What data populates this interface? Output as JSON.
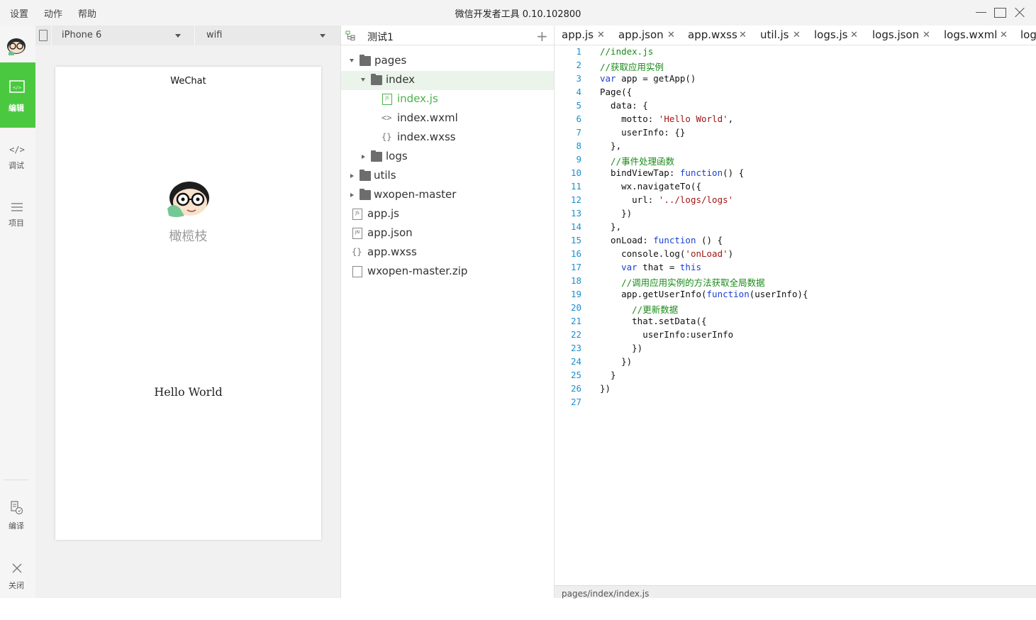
{
  "menu": [
    "设置",
    "动作",
    "帮助"
  ],
  "app_title": "微信开发者工具 0.10.102800",
  "sidebar": {
    "items": [
      {
        "label": "编辑",
        "icon": "code-box-icon",
        "active": true
      },
      {
        "label": "调试",
        "icon": "code-brackets-icon",
        "active": false
      },
      {
        "label": "项目",
        "icon": "list-icon",
        "active": false
      },
      {
        "label": "编译",
        "icon": "compile-icon",
        "active": false
      },
      {
        "label": "关闭",
        "icon": "close-icon",
        "active": false
      }
    ]
  },
  "simulator": {
    "device": "iPhone 6",
    "network": "wifi",
    "nav_title": "WeChat",
    "nickname": "橄榄枝",
    "motto": "Hello World"
  },
  "file_tree": {
    "project": "测试1",
    "rows": [
      {
        "name": "pages",
        "type": "folder",
        "expanded": true
      },
      {
        "name": "index",
        "type": "folder",
        "expanded": true
      },
      {
        "name": "index.js",
        "type": "js",
        "tag": "JS"
      },
      {
        "name": "index.wxml",
        "type": "wxml",
        "tag": "<>"
      },
      {
        "name": "index.wxss",
        "type": "wxss",
        "tag": "{}"
      },
      {
        "name": "logs",
        "type": "folder",
        "expanded": false
      },
      {
        "name": "utils",
        "type": "folder",
        "expanded": false
      },
      {
        "name": "wxopen-master",
        "type": "folder",
        "expanded": false
      },
      {
        "name": "app.js",
        "type": "js",
        "tag": "JS"
      },
      {
        "name": "app.json",
        "type": "json",
        "tag": "JN"
      },
      {
        "name": "app.wxss",
        "type": "wxss",
        "tag": "{}"
      },
      {
        "name": "wxopen-master.zip",
        "type": "file",
        "tag": ""
      }
    ]
  },
  "editor": {
    "tabs": [
      "app.js",
      "app.json",
      "app.wxss",
      "util.js",
      "logs.js",
      "logs.json",
      "logs.wxml",
      "log"
    ],
    "code": [
      [
        [
          "c",
          "//index.js"
        ]
      ],
      [
        [
          "c",
          "//获取应用实例"
        ]
      ],
      [
        [
          "k",
          "var"
        ],
        [
          "t",
          " app = getApp()"
        ]
      ],
      [
        [
          "t",
          "Page({"
        ]
      ],
      [
        [
          "t",
          "  data: {"
        ]
      ],
      [
        [
          "t",
          "    motto: "
        ],
        [
          "s",
          "'Hello World'"
        ],
        [
          "t",
          ","
        ]
      ],
      [
        [
          "t",
          "    userInfo: {}"
        ]
      ],
      [
        [
          "t",
          "  },"
        ]
      ],
      [
        [
          "c",
          "  //事件处理函数"
        ]
      ],
      [
        [
          "t",
          "  bindViewTap: "
        ],
        [
          "k",
          "function"
        ],
        [
          "t",
          "() {"
        ]
      ],
      [
        [
          "t",
          "    wx.navigateTo({"
        ]
      ],
      [
        [
          "t",
          "      url: "
        ],
        [
          "s",
          "'../logs/logs'"
        ]
      ],
      [
        [
          "t",
          "    })"
        ]
      ],
      [
        [
          "t",
          "  },"
        ]
      ],
      [
        [
          "t",
          "  onLoad: "
        ],
        [
          "k",
          "function"
        ],
        [
          "t",
          " () {"
        ]
      ],
      [
        [
          "t",
          "    console.log("
        ],
        [
          "s",
          "'onLoad'"
        ],
        [
          "t",
          ")"
        ]
      ],
      [
        [
          "t",
          "    "
        ],
        [
          "k",
          "var"
        ],
        [
          "t",
          " that = "
        ],
        [
          "k",
          "this"
        ]
      ],
      [
        [
          "c",
          "    //调用应用实例的方法获取全局数据"
        ]
      ],
      [
        [
          "t",
          "    app.getUserInfo("
        ],
        [
          "k",
          "function"
        ],
        [
          "t",
          "(userInfo){"
        ]
      ],
      [
        [
          "c",
          "      //更新数据"
        ]
      ],
      [
        [
          "t",
          "      that.setData({"
        ]
      ],
      [
        [
          "t",
          "        userInfo:userInfo"
        ]
      ],
      [
        [
          "t",
          "      })"
        ]
      ],
      [
        [
          "t",
          "    })"
        ]
      ],
      [
        [
          "t",
          "  }"
        ]
      ],
      [
        [
          "t",
          "})"
        ]
      ],
      [
        [
          "t",
          ""
        ]
      ]
    ],
    "status_path": "pages/index/index.js"
  }
}
